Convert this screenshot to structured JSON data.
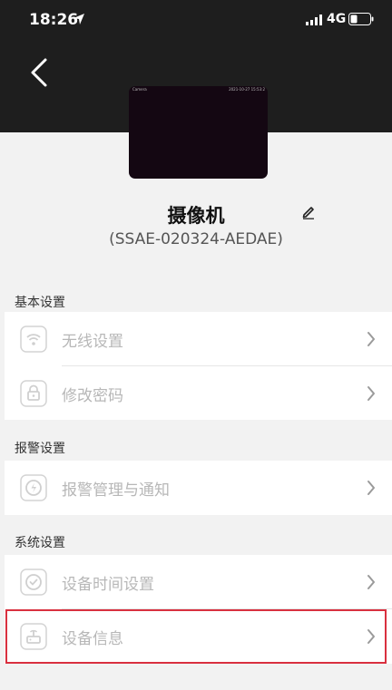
{
  "status_bar": {
    "time": "18:26",
    "network": "4G"
  },
  "preview": {
    "label": "Camera",
    "timestamp": "2021-10-27 15:53:2"
  },
  "device": {
    "name": "摄像机",
    "id": "(SSAE-020324-AEDAE)"
  },
  "sections": {
    "basic": {
      "title": "基本设置",
      "items": [
        {
          "label": "无线设置",
          "icon": "wifi-icon"
        },
        {
          "label": "修改密码",
          "icon": "lock-icon"
        }
      ]
    },
    "alarm": {
      "title": "报警设置",
      "items": [
        {
          "label": "报警管理与通知",
          "icon": "alarm-icon"
        }
      ]
    },
    "system": {
      "title": "系统设置",
      "items": [
        {
          "label": "设备时间设置",
          "icon": "clock-icon"
        },
        {
          "label": "设备信息",
          "icon": "router-icon"
        }
      ]
    }
  },
  "colors": {
    "highlight": "#d9303f",
    "header": "#1e1e1e",
    "icon_gray": "#cfcfcf"
  }
}
